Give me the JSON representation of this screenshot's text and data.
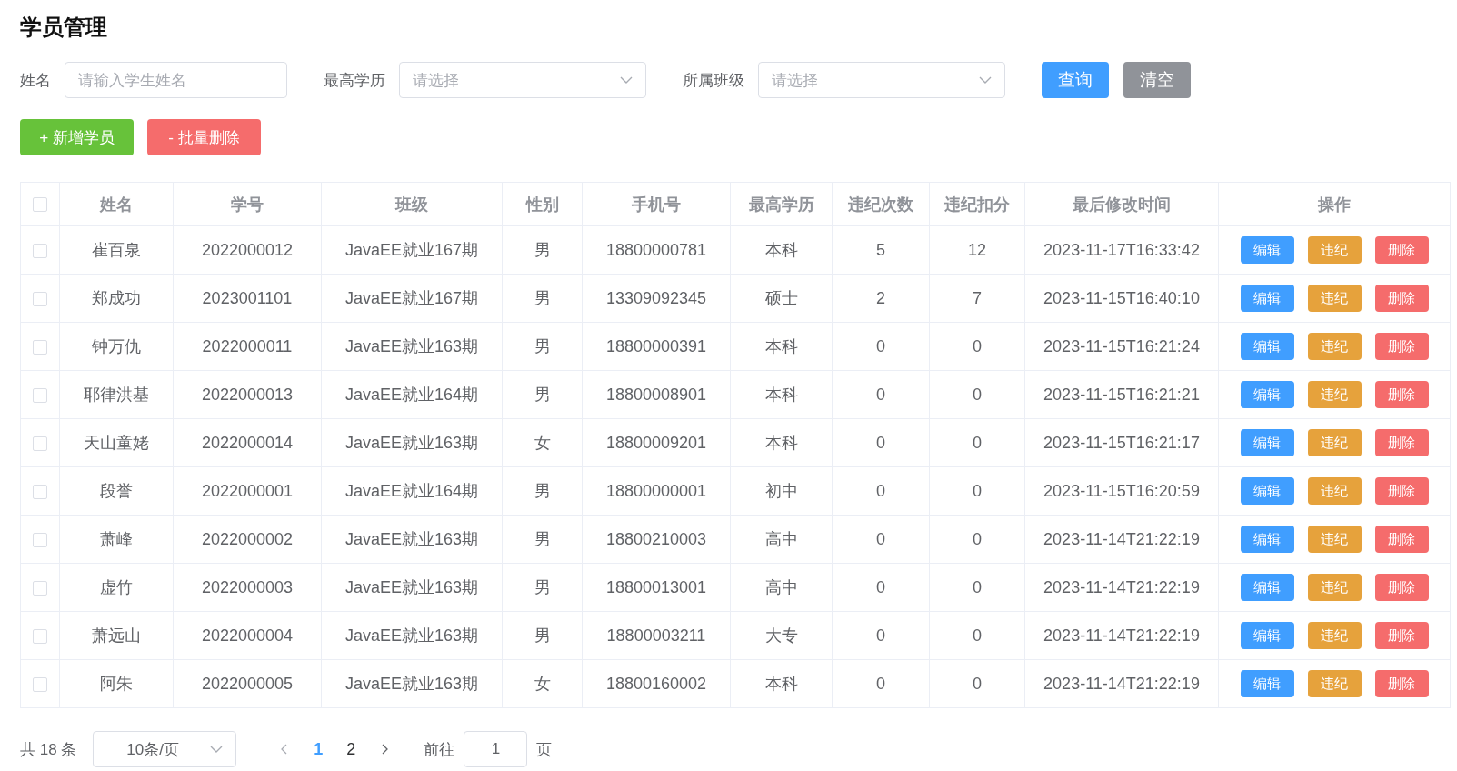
{
  "page_title": "学员管理",
  "filters": [
    {
      "kind": "input",
      "label": "姓名",
      "placeholder": "请输入学生姓名"
    },
    {
      "kind": "select",
      "label": "最高学历",
      "placeholder": "请选择"
    },
    {
      "kind": "select",
      "label": "所属班级",
      "placeholder": "请选择"
    }
  ],
  "filter_buttons": [
    {
      "kind": "primary",
      "label": "查询"
    },
    {
      "kind": "info",
      "label": "清空"
    }
  ],
  "action_buttons": [
    {
      "kind": "success",
      "label": "+ 新增学员"
    },
    {
      "kind": "danger",
      "label": "- 批量删除"
    }
  ],
  "table": {
    "header_checked": false,
    "columns": [
      "姓名",
      "学号",
      "班级",
      "性别",
      "手机号",
      "最高学历",
      "违纪次数",
      "违纪扣分",
      "最后修改时间",
      "操作"
    ],
    "rows": [
      {
        "checked": false,
        "cells": [
          "崔百泉",
          "2022000012",
          "JavaEE就业167期",
          "男",
          "18800000781",
          "本科",
          "5",
          "12",
          "2023-11-17T16:33:42"
        ],
        "buttons": [
          {
            "kind": "primary",
            "label": "编辑"
          },
          {
            "kind": "warning",
            "label": "违纪"
          },
          {
            "kind": "danger",
            "label": "删除"
          }
        ]
      },
      {
        "checked": false,
        "cells": [
          "郑成功",
          "2023001101",
          "JavaEE就业167期",
          "男",
          "13309092345",
          "硕士",
          "2",
          "7",
          "2023-11-15T16:40:10"
        ],
        "buttons": [
          {
            "kind": "primary",
            "label": "编辑"
          },
          {
            "kind": "warning",
            "label": "违纪"
          },
          {
            "kind": "danger",
            "label": "删除"
          }
        ]
      },
      {
        "checked": false,
        "cells": [
          "钟万仇",
          "2022000011",
          "JavaEE就业163期",
          "男",
          "18800000391",
          "本科",
          "0",
          "0",
          "2023-11-15T16:21:24"
        ],
        "buttons": [
          {
            "kind": "primary",
            "label": "编辑"
          },
          {
            "kind": "warning",
            "label": "违纪"
          },
          {
            "kind": "danger",
            "label": "删除"
          }
        ]
      },
      {
        "checked": false,
        "cells": [
          "耶律洪基",
          "2022000013",
          "JavaEE就业164期",
          "男",
          "18800008901",
          "本科",
          "0",
          "0",
          "2023-11-15T16:21:21"
        ],
        "buttons": [
          {
            "kind": "primary",
            "label": "编辑"
          },
          {
            "kind": "warning",
            "label": "违纪"
          },
          {
            "kind": "danger",
            "label": "删除"
          }
        ]
      },
      {
        "checked": false,
        "cells": [
          "天山童姥",
          "2022000014",
          "JavaEE就业163期",
          "女",
          "18800009201",
          "本科",
          "0",
          "0",
          "2023-11-15T16:21:17"
        ],
        "buttons": [
          {
            "kind": "primary",
            "label": "编辑"
          },
          {
            "kind": "warning",
            "label": "违纪"
          },
          {
            "kind": "danger",
            "label": "删除"
          }
        ]
      },
      {
        "checked": false,
        "cells": [
          "段誉",
          "2022000001",
          "JavaEE就业164期",
          "男",
          "18800000001",
          "初中",
          "0",
          "0",
          "2023-11-15T16:20:59"
        ],
        "buttons": [
          {
            "kind": "primary",
            "label": "编辑"
          },
          {
            "kind": "warning",
            "label": "违纪"
          },
          {
            "kind": "danger",
            "label": "删除"
          }
        ]
      },
      {
        "checked": false,
        "cells": [
          "萧峰",
          "2022000002",
          "JavaEE就业163期",
          "男",
          "18800210003",
          "高中",
          "0",
          "0",
          "2023-11-14T21:22:19"
        ],
        "buttons": [
          {
            "kind": "primary",
            "label": "编辑"
          },
          {
            "kind": "warning",
            "label": "违纪"
          },
          {
            "kind": "danger",
            "label": "删除"
          }
        ]
      },
      {
        "checked": false,
        "cells": [
          "虚竹",
          "2022000003",
          "JavaEE就业163期",
          "男",
          "18800013001",
          "高中",
          "0",
          "0",
          "2023-11-14T21:22:19"
        ],
        "buttons": [
          {
            "kind": "primary",
            "label": "编辑"
          },
          {
            "kind": "warning",
            "label": "违纪"
          },
          {
            "kind": "danger",
            "label": "删除"
          }
        ]
      },
      {
        "checked": false,
        "cells": [
          "萧远山",
          "2022000004",
          "JavaEE就业163期",
          "男",
          "18800003211",
          "大专",
          "0",
          "0",
          "2023-11-14T21:22:19"
        ],
        "buttons": [
          {
            "kind": "primary",
            "label": "编辑"
          },
          {
            "kind": "warning",
            "label": "违纪"
          },
          {
            "kind": "danger",
            "label": "删除"
          }
        ]
      },
      {
        "checked": false,
        "cells": [
          "阿朱",
          "2022000005",
          "JavaEE就业163期",
          "女",
          "18800160002",
          "本科",
          "0",
          "0",
          "2023-11-14T21:22:19"
        ],
        "buttons": [
          {
            "kind": "primary",
            "label": "编辑"
          },
          {
            "kind": "warning",
            "label": "违纪"
          },
          {
            "kind": "danger",
            "label": "删除"
          }
        ]
      }
    ]
  },
  "pagination": {
    "total": "共 18 条",
    "page_size": "10条/页",
    "pages": [
      {
        "label": "1",
        "selected": true
      },
      {
        "label": "2",
        "selected": false
      }
    ],
    "goto_label": "前往",
    "goto_value": "1",
    "goto_suffix": "页"
  }
}
